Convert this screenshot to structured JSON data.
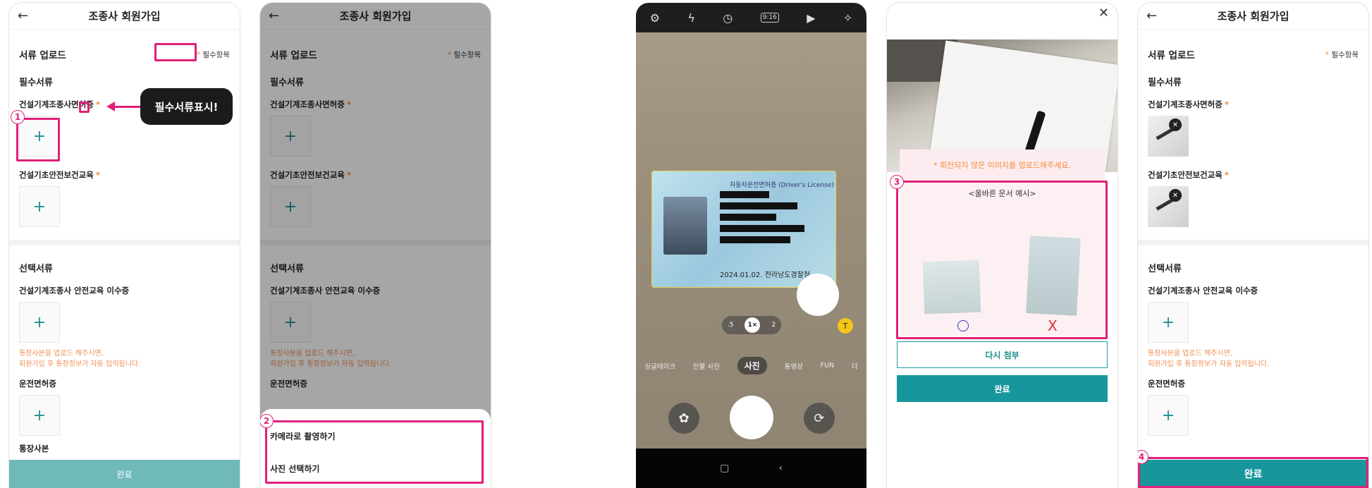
{
  "app": {
    "title": "조종사 회원가입",
    "back_icon": "←",
    "upload_section": "서류 업로드",
    "required_mark": "필수항목",
    "required_docs": "필수서류",
    "optional_docs": "선택서류",
    "doc_construction_license": "건설기계조종사면허증",
    "doc_safety_education": "건설기초안전보건교육",
    "doc_safety_cert": "건설기계조종사 안전교육 이수증",
    "bank_note_line1": "통장사본을 업로드 해주시면,",
    "bank_note_line2": "회원가입 후 통장정보가 자동 입력됩니다.",
    "doc_driver_license": "운전면허증",
    "doc_bank_partial": "통장사본",
    "complete_button": "완료",
    "plus": "+"
  },
  "annotation": {
    "tooltip": "필수서류표시!",
    "badge1": "1",
    "badge2": "2",
    "badge3": "3",
    "badge4": "4",
    "accent": "#e0207a"
  },
  "sheet": {
    "camera_option": "카메라로 촬영하기",
    "photo_option": "사진 선택하기"
  },
  "camera": {
    "top_icons": [
      "gear-icon",
      "flash-icon",
      "timer-icon",
      "ratio-icon",
      "motion-icon",
      "effects-icon"
    ],
    "ratio_label": "9:16",
    "zoom": [
      ".5",
      "1×",
      "2"
    ],
    "modes": [
      "싱글테이크",
      "인물 사진",
      "사진",
      "동영상",
      "FUN",
      "더"
    ],
    "selected_mode": "사진",
    "card_title": "자동차운전면허증 (Driver's License)",
    "card_address": "2024.01.02. 전라남도경찰청",
    "nav_home": "▢",
    "nav_back": "‹"
  },
  "preview": {
    "warning": "* 회전되지 않은 이미지를 업로드해주세요.",
    "example_title": "<올바른 문서 예시>",
    "wrong_mark": "X",
    "reattach_button": "다시 첨부",
    "done_button": "완료"
  },
  "colors": {
    "teal": "#17969c",
    "teal_light": "#6fb9bb",
    "orange": "#f28c38"
  }
}
